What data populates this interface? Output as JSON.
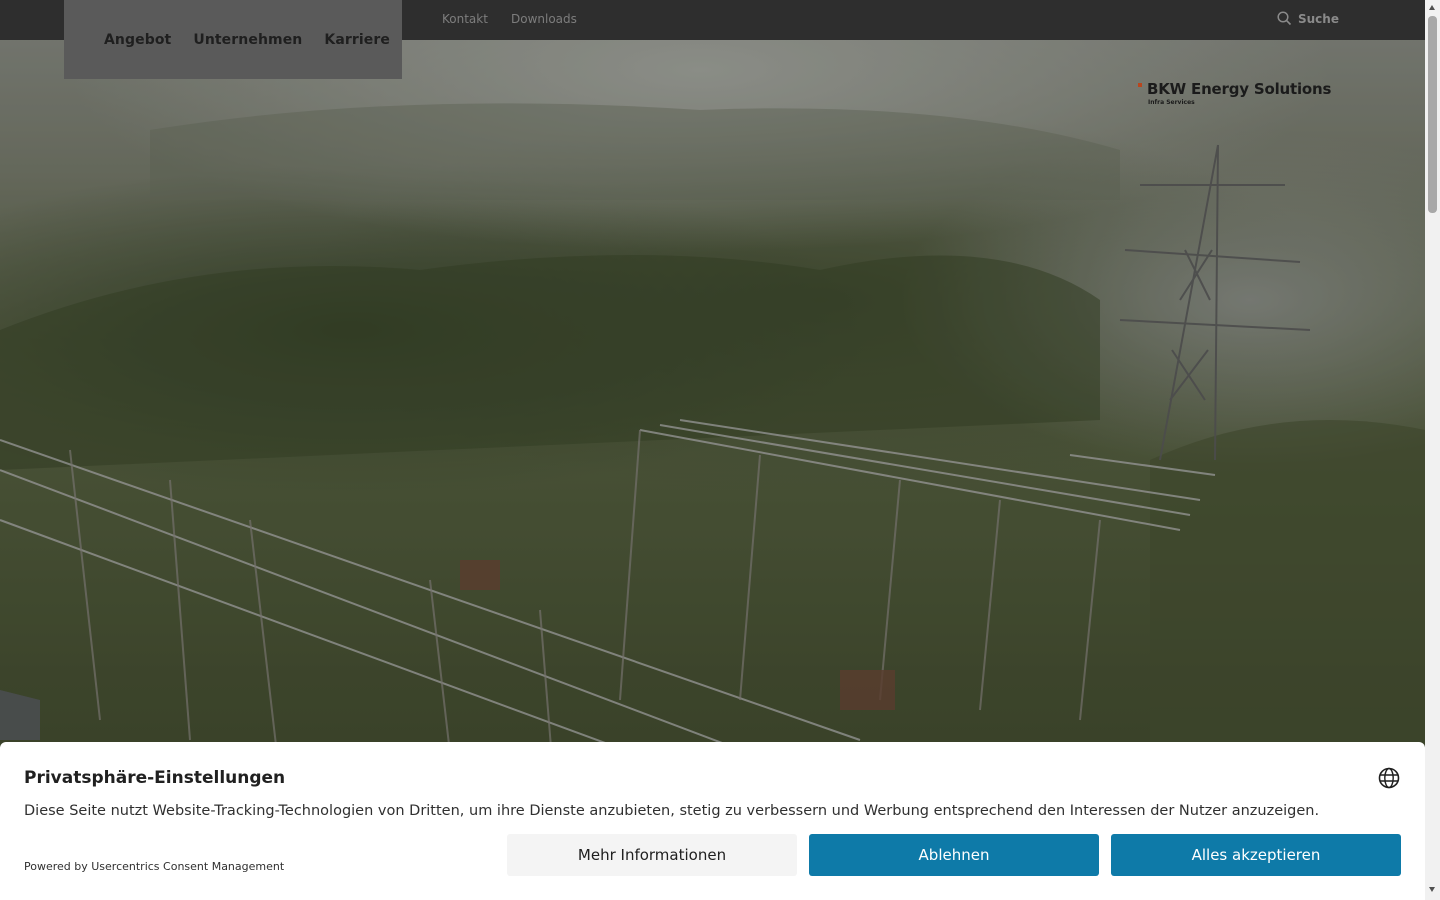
{
  "topbar": {
    "utility_links": [
      "Kontakt",
      "Downloads"
    ],
    "search_label": "Suche"
  },
  "mainnav": {
    "items": [
      "Angebot",
      "Unternehmen",
      "Karriere"
    ]
  },
  "logo": {
    "name": "BKW Energy Solutions",
    "sub": "Infra Services",
    "accent_color": "#b8461e"
  },
  "consent": {
    "title": "Privatsphäre-Einstellungen",
    "description": "Diese Seite nutzt Website-Tracking-Technologien von Dritten, um ihre Dienste anzubieten, stetig zu verbessern und Werbung entsprechend den Interessen der Nutzer anzuzeigen.",
    "powered_by": "Powered by Usercentrics Consent Management",
    "buttons": {
      "more": "Mehr Informationen",
      "deny": "Ablehnen",
      "accept": "Alles akzeptieren"
    },
    "button_color": "#0e7aa8"
  },
  "icons": {
    "search": "search-icon",
    "language": "globe-icon"
  }
}
